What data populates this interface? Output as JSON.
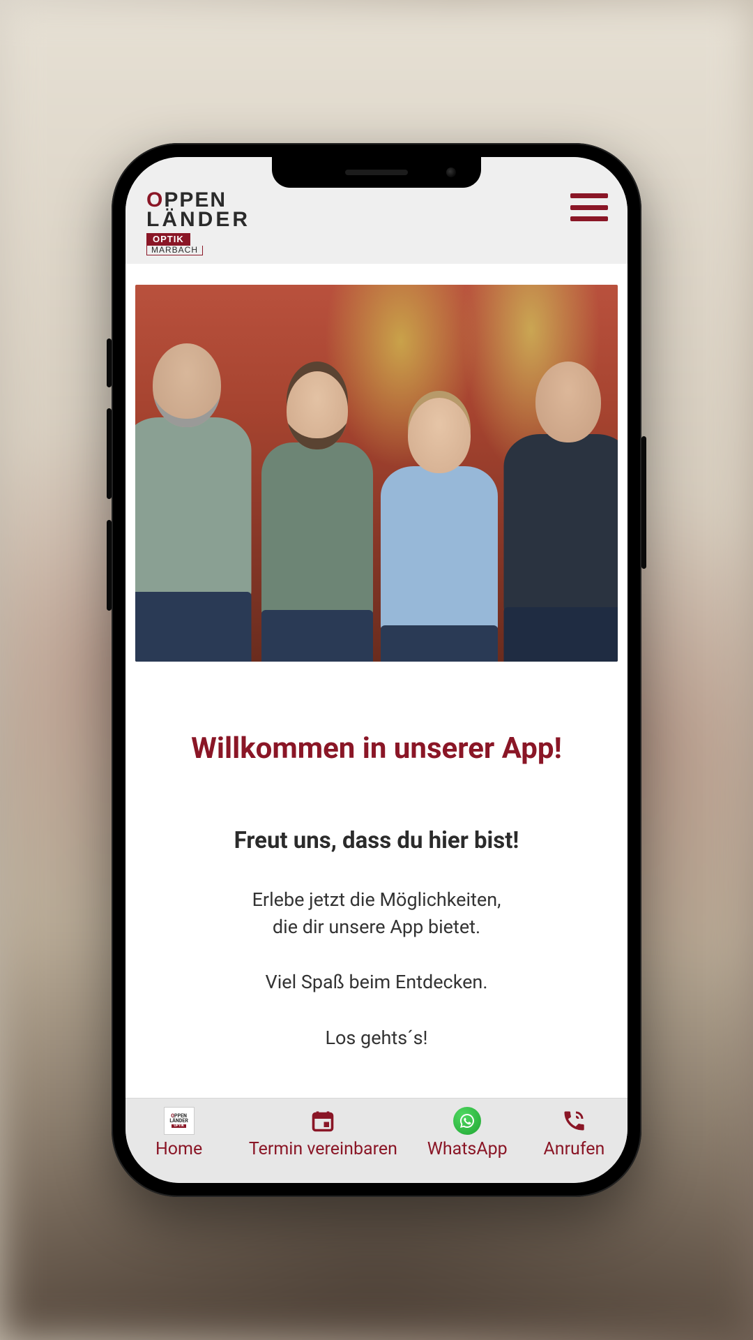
{
  "logo": {
    "line1_first_letter": "O",
    "line1_rest": "PPEN",
    "line2": "LÄNDER",
    "badge": "OPTIK",
    "sub": "MARBACH"
  },
  "welcome": {
    "title": "Willkommen in unserer App!",
    "subtitle": "Freut uns, dass du hier bist!",
    "p1a": "Erlebe jetzt die Möglichkeiten,",
    "p1b": "die dir unsere App bietet.",
    "p2": "Viel Spaß beim Entdecken.",
    "p3": "Los gehts´s!"
  },
  "nav": {
    "home": "Home",
    "appointment": "Termin vereinbaren",
    "whatsapp": "WhatsApp",
    "call": "Anrufen"
  },
  "colors": {
    "brand": "#8a1626",
    "whatsapp": "#25D366"
  }
}
